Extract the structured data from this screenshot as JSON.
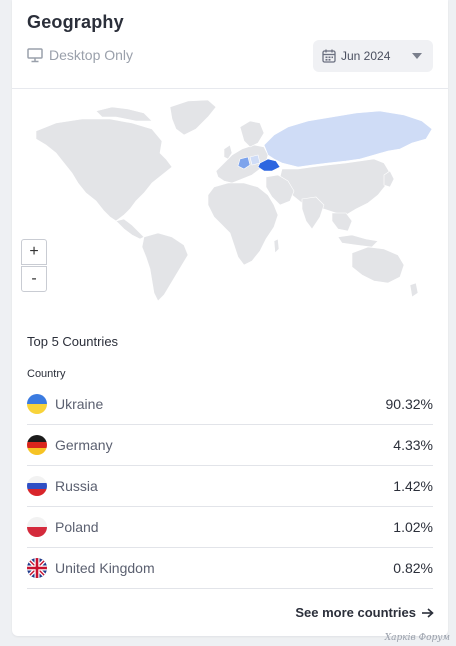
{
  "header": {
    "title": "Geography",
    "device_label": "Desktop Only",
    "date_value": "Jun 2024"
  },
  "map": {
    "zoom_in_label": "+",
    "zoom_out_label": "-",
    "land_color": "#e3e4e7",
    "highlight_light": "#cfdcf6",
    "highlight_medium": "#7ea4ec",
    "highlight_strong": "#2d66e0"
  },
  "top_countries": {
    "title": "Top 5 Countries",
    "column_header": "Country",
    "rows": [
      {
        "country": "Ukraine",
        "percent": "90.32%",
        "flag": "ukraine-flag"
      },
      {
        "country": "Germany",
        "percent": "4.33%",
        "flag": "germany-flag"
      },
      {
        "country": "Russia",
        "percent": "1.42%",
        "flag": "russia-flag"
      },
      {
        "country": "Poland",
        "percent": "1.02%",
        "flag": "poland-flag"
      },
      {
        "country": "United Kingdom",
        "percent": "0.82%",
        "flag": "uk-flag"
      }
    ]
  },
  "footer": {
    "see_more_label": "See more countries"
  },
  "watermark": "Харків Форум"
}
